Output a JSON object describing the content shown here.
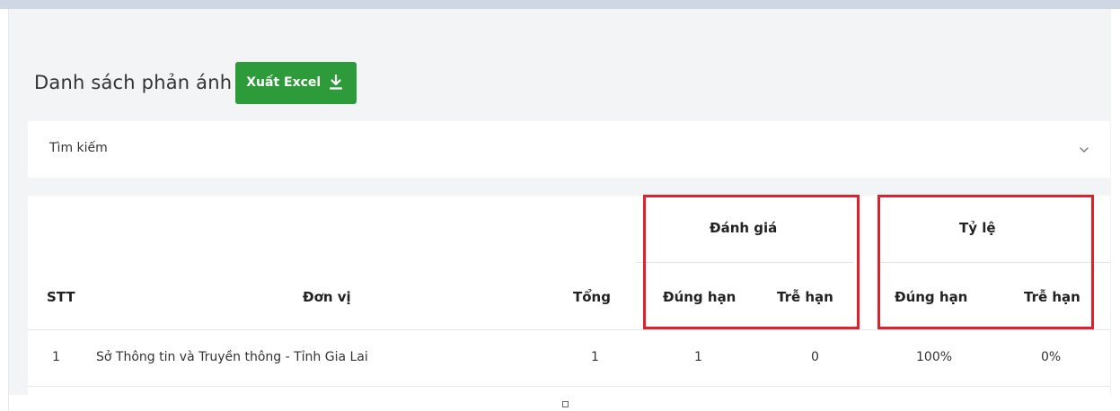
{
  "page": {
    "title": "Danh sách phản ánh",
    "export_label": "Xuất Excel",
    "export_icon": "download-icon",
    "accent_color": "#2e9b3a",
    "highlight_color": "#e0202a"
  },
  "search": {
    "label": "Tìm kiếm",
    "toggle_icon": "chevron-down-icon"
  },
  "table": {
    "group_headers": {
      "danh_gia": "Đánh giá",
      "ty_le": "Tỷ lệ"
    },
    "headers": {
      "stt": "STT",
      "don_vi": "Đơn vị",
      "tong": "Tổng",
      "dg_dung_han": "Đúng hạn",
      "dg_tre_han": "Trễ hạn",
      "tl_dung_han": "Đúng hạn",
      "tl_tre_han": "Trễ hạn"
    },
    "rows": [
      {
        "stt": "1",
        "don_vi": "Sở Thông tin và Truyền thông - Tỉnh Gia Lai",
        "tong": "1",
        "dg_dung_han": "1",
        "dg_tre_han": "0",
        "tl_dung_han": "100%",
        "tl_tre_han": "0%"
      }
    ]
  }
}
